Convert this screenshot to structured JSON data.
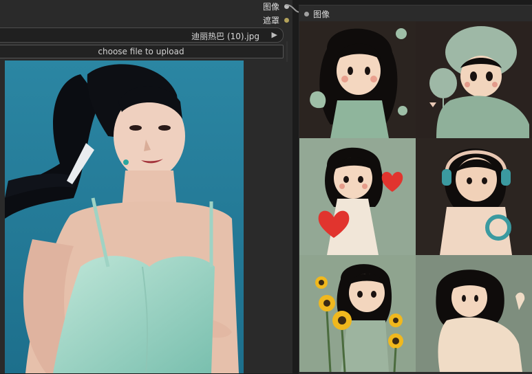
{
  "left_node": {
    "outputs": [
      {
        "label": "图像",
        "dot_color": "#bcbcbc"
      },
      {
        "label": "遮罩",
        "dot_color": "#b3a25a"
      }
    ],
    "file_select": {
      "value": "迪丽热巴 (10).jpg",
      "arrow": "▶"
    },
    "upload_button": "choose file to upload"
  },
  "right_node": {
    "title": "图像",
    "title_dot_color": "#a0a0a0",
    "tiles": [
      {
        "bg": "#2b2420"
      },
      {
        "bg": "#2a221f"
      },
      {
        "bg": "#93a895"
      },
      {
        "bg": "#2c2521"
      },
      {
        "bg": "#8fa48f"
      },
      {
        "bg": "#7e8e7e"
      }
    ]
  }
}
